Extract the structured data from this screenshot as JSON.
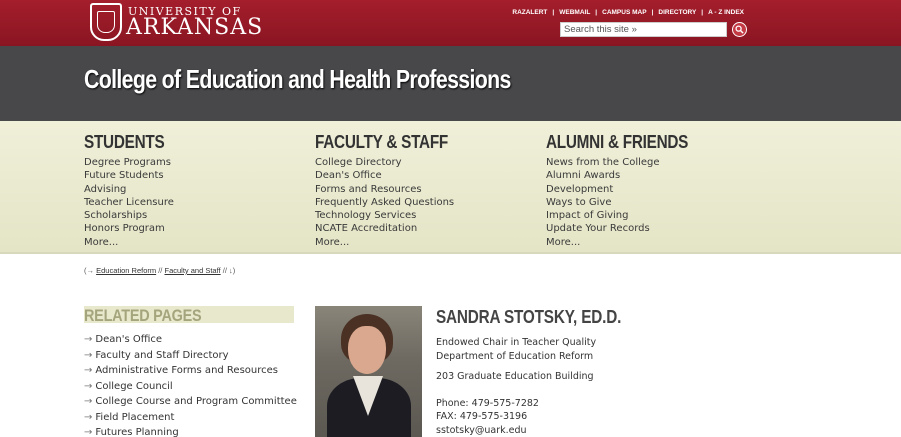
{
  "header": {
    "logo_line1": "UNIVERSITY OF",
    "logo_line2": "ARKANSAS",
    "links": [
      "RAZALERT",
      "WEBMAIL",
      "CAMPUS MAP",
      "DIRECTORY",
      "A - Z INDEX"
    ],
    "search_placeholder": "Search this site »"
  },
  "title": "College of Education and Health Professions",
  "nav": {
    "students": {
      "heading": "STUDENTS",
      "items": [
        "Degree Programs",
        "Future Students",
        "Advising",
        "Teacher Licensure",
        "Scholarships",
        "Honors Program",
        "More..."
      ]
    },
    "faculty": {
      "heading": "FACULTY & STAFF",
      "items": [
        "College Directory",
        "Dean's Office",
        "Forms and Resources",
        "Frequently Asked Questions",
        "Technology Services",
        "NCATE Accreditation",
        "More..."
      ]
    },
    "alumni": {
      "heading": "ALUMNI & FRIENDS",
      "items": [
        "News from the College",
        "Alumni Awards",
        "Development",
        "Ways to Give",
        "Impact of Giving",
        "Update Your Records",
        "More..."
      ]
    }
  },
  "breadcrumb": {
    "prefix": "(→",
    "link1": "Education Reform",
    "sep": "//",
    "link2": "Faculty and Staff",
    "suffix": "// ↓)"
  },
  "related": {
    "heading": "RELATED PAGES",
    "arrow": "→",
    "items": [
      "Dean's Office",
      "Faculty and Staff Directory",
      "Administrative Forms and Resources",
      "College Council",
      "College Course and Program Committee",
      "Field Placement",
      "Futures Planning"
    ]
  },
  "profile": {
    "name": "SANDRA STOTSKY, ED.D.",
    "title1": "Endowed Chair in Teacher Quality",
    "title2": "Department of Education Reform",
    "building": "203 Graduate Education Building",
    "phone": "Phone: 479-575-7282",
    "fax": "FAX: 479-575-3196",
    "email": "sstotsky@uark.edu"
  },
  "colors": {
    "brand_red": "#9d1c2a",
    "title_band": "#48484b",
    "nav_bg": "#ecebd2"
  }
}
